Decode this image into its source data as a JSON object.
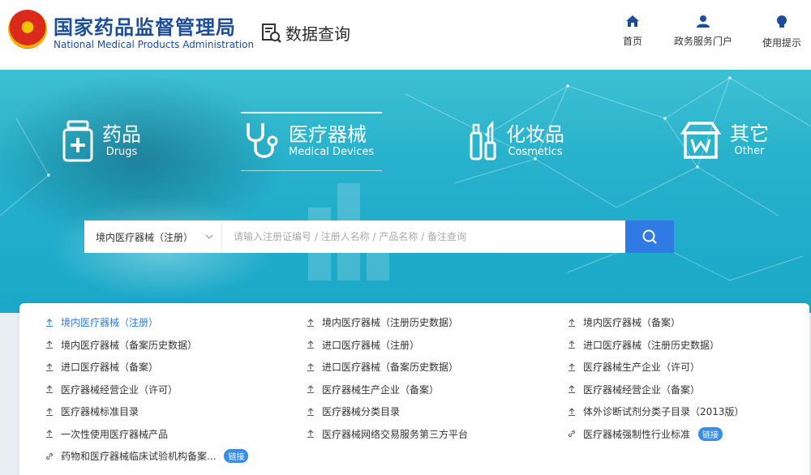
{
  "header": {
    "org_cn": "国家药品监督管理局",
    "org_en": "National Medical Products Administration",
    "data_query": "数据查询",
    "nav": [
      {
        "label": "首页",
        "icon": "home-icon"
      },
      {
        "label": "政务服务门户",
        "icon": "user-icon"
      },
      {
        "label": "使用提示",
        "icon": "lightbulb-icon"
      }
    ]
  },
  "categories": [
    {
      "cn": "药品",
      "en": "Drugs",
      "icon": "medicine-box-icon"
    },
    {
      "cn": "医疗器械",
      "en": "Medical Devices",
      "icon": "stethoscope-icon",
      "active": true
    },
    {
      "cn": "化妆品",
      "en": "Cosmetics",
      "icon": "cosmetics-bottle-icon"
    },
    {
      "cn": "其它",
      "en": "Other",
      "icon": "store-icon"
    }
  ],
  "search": {
    "category_selected": "境内医疗器械（注册）",
    "placeholder": "请输入注册证编号 / 注册人名称 / 产品名称 / 备注查询"
  },
  "links": [
    {
      "label": "境内医疗器械（注册）",
      "icon": "upload",
      "active": true
    },
    {
      "label": "境内医疗器械（注册历史数据）",
      "icon": "upload"
    },
    {
      "label": "境内医疗器械（备案）",
      "icon": "upload"
    },
    {
      "label": "境内医疗器械（备案历史数据）",
      "icon": "upload"
    },
    {
      "label": "进口医疗器械（注册）",
      "icon": "upload"
    },
    {
      "label": "进口医疗器械（注册历史数据）",
      "icon": "upload"
    },
    {
      "label": "进口医疗器械（备案）",
      "icon": "upload"
    },
    {
      "label": "进口医疗器械（备案历史数据）",
      "icon": "upload"
    },
    {
      "label": "医疗器械生产企业（许可）",
      "icon": "upload"
    },
    {
      "label": "医疗器械经营企业（许可）",
      "icon": "upload"
    },
    {
      "label": "医疗器械生产企业（备案）",
      "icon": "upload"
    },
    {
      "label": "医疗器械经营企业（备案）",
      "icon": "upload"
    },
    {
      "label": "医疗器械标准目录",
      "icon": "upload"
    },
    {
      "label": "医疗器械分类目录",
      "icon": "upload"
    },
    {
      "label": "体外诊断试剂分类子目录（2013版）",
      "icon": "upload"
    },
    {
      "label": "一次性使用医疗器械产品",
      "icon": "upload"
    },
    {
      "label": "医疗器械网络交易服务第三方平台",
      "icon": "upload"
    },
    {
      "label": "医疗器械强制性行业标准",
      "icon": "link",
      "tag": "链接"
    },
    {
      "label": "药物和医疗器械临床试验机构备案...",
      "icon": "link",
      "tag": "链接"
    }
  ],
  "colors": {
    "brand_blue": "#1b4d9b",
    "accent": "#2f7ae5",
    "banner": "#26b0cb"
  }
}
